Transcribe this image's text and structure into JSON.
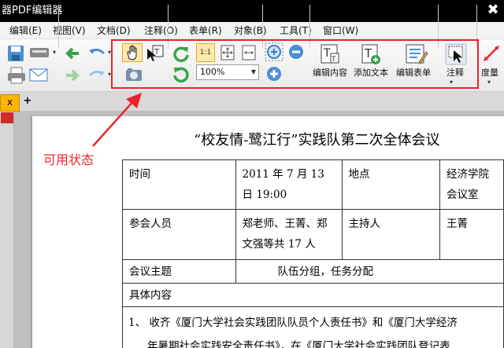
{
  "window": {
    "title": "器PDF编辑器",
    "close_glyph": "✖"
  },
  "menu": [
    "编辑(E)",
    "视图(V)",
    "文档(D)",
    "注释(O)",
    "表单(R)",
    "对象(B)",
    "工具(T)",
    "窗口(W)"
  ],
  "toolbar": {
    "zoom_value": "100%",
    "edit_content_label": "编辑内容",
    "add_text_label": "添加文本",
    "edit_form_label": "编辑表单",
    "annotation_label": "注释",
    "measure_label": "度量",
    "fit_page_label": "1:1"
  },
  "annotation_text": "可用状态",
  "annotation_color": "#e8252b",
  "tab": {
    "label": "x",
    "new_tab": "+"
  },
  "document": {
    "title": "“校友情-鹭江行”实践队第二次全体会议",
    "rows": [
      {
        "c1": "时间",
        "c2": "2011 年 7 月 13 日 19:00",
        "c3": "地点",
        "c4": "经济学院会议室"
      },
      {
        "c1": "参会人员",
        "c2": "郑老师、王菁、郑文强等共 17 人",
        "c3": "主持人",
        "c4": "王菁"
      }
    ],
    "theme_label": "会议主题",
    "theme_value": "队伍分组，任务分配",
    "details_label": "具体内容",
    "line1": "1、 收齐《厦门大学社会实践团队队员个人责任书》和《厦门大学经济",
    "line2": "年暑期社会实践安全责任书》，在《厦门大学社会实践团队登记表"
  }
}
